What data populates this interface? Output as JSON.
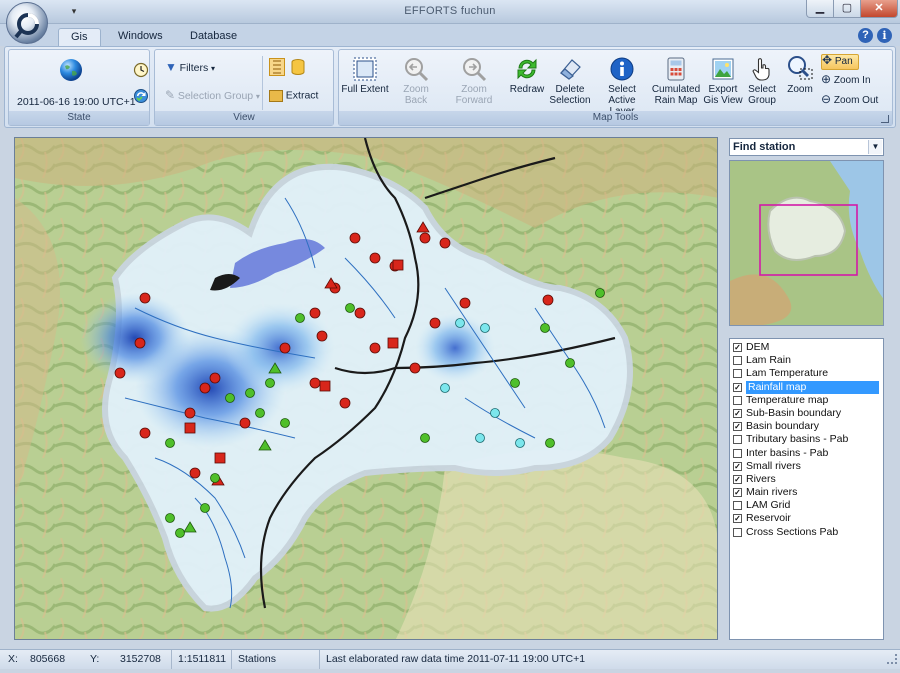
{
  "window": {
    "title": "EFFORTS fuchun",
    "qat_glyph": "▾",
    "min_glyph": "▁",
    "max_glyph": "▢",
    "close_glyph": "✕"
  },
  "tabs": [
    {
      "label": "Gis",
      "active": true
    },
    {
      "label": "Windows"
    },
    {
      "label": "Database"
    }
  ],
  "help_glyph": "?",
  "info_glyph": "i",
  "ribbon": {
    "state": {
      "datetime": "2011-06-16 19:00 UTC+1",
      "group_label": "State"
    },
    "view": {
      "filters": "Filters",
      "filters_arrow": "▾",
      "selection_group": "Selection Group",
      "selection_group_arrow": "▾",
      "extract": "Extract",
      "group_label": "View"
    },
    "map_tools": {
      "full_extent": "Full Extent",
      "zoom_back": "Zoom Back",
      "zoom_forward": "Zoom Forward",
      "redraw": "Redraw",
      "delete_selection_1": "Delete",
      "delete_selection_2": "Selection",
      "select_active_layer_1": "Select",
      "select_active_layer_2": "Active Layer",
      "cumulated_rain_map_1": "Cumulated",
      "cumulated_rain_map_2": "Rain Map",
      "export_gis_view_1": "Export",
      "export_gis_view_2": "Gis View",
      "select_group_1": "Select",
      "select_group_2": "Group",
      "zoom": "Zoom",
      "pan": "Pan",
      "zoom_in": "Zoom In",
      "zoom_out": "Zoom Out",
      "group_label": "Map Tools"
    }
  },
  "find_station": {
    "placeholder": "Find station",
    "arrow": "▼"
  },
  "layers": [
    {
      "label": "DEM",
      "checked": true
    },
    {
      "label": "Lam Rain",
      "checked": false
    },
    {
      "label": "Lam Temperature",
      "checked": false
    },
    {
      "label": "Rainfall map",
      "checked": true,
      "selected": true
    },
    {
      "label": "Temperature map",
      "checked": false
    },
    {
      "label": "Sub-Basin boundary",
      "checked": true
    },
    {
      "label": "Basin boundary",
      "checked": true
    },
    {
      "label": "Tributary basins - Pab",
      "checked": false
    },
    {
      "label": "Inter basins - Pab",
      "checked": false
    },
    {
      "label": "Small rivers",
      "checked": true
    },
    {
      "label": "Rivers",
      "checked": true
    },
    {
      "label": "Main rivers",
      "checked": true
    },
    {
      "label": "LAM Grid",
      "checked": false
    },
    {
      "label": "Reservoir",
      "checked": true
    },
    {
      "label": "Cross Sections Pab",
      "checked": false
    }
  ],
  "check_glyph": "✓",
  "statusbar": {
    "x_label": "X:",
    "x_value": "805668",
    "y_label": "Y:",
    "y_value": "3152708",
    "scale": "1:1511811",
    "layer": "Stations",
    "last_label": "Last elaborated raw data time",
    "last_value": "2011-07-11 19:00 UTC+1"
  },
  "colors": {
    "ribbon_bg": "#dbe6f3",
    "station_red": "#d8261b",
    "station_green": "#4fbf2a",
    "station_cyan": "#7be6ec",
    "rain_blue": "#2f63c7",
    "selection": "#3399ff"
  }
}
